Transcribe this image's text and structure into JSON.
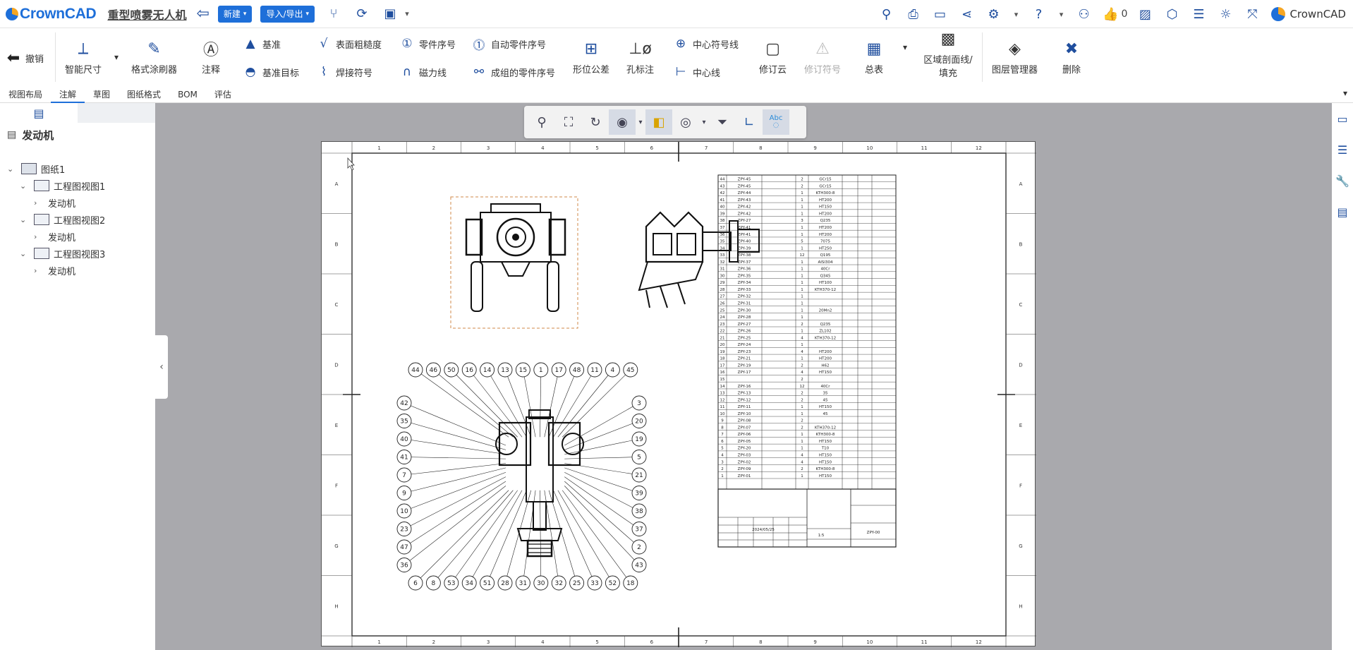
{
  "app": {
    "brand": "CrownCAD",
    "doc_title": "重型喷雾无人机",
    "new_label": "新建",
    "import_export_label": "导入/导出",
    "like_count": "0",
    "user_brand": "CrownCAD"
  },
  "ribbon": {
    "undo": "撤销",
    "smart_dimension": "智能尺寸",
    "format_painter": "格式涂刷器",
    "note": "注释",
    "datum": "基准",
    "datum_target": "基准目标",
    "surface_roughness": "表面粗糙度",
    "weld_symbol": "焊接符号",
    "balloon": "零件序号",
    "magnetic_line": "磁力线",
    "auto_balloon": "自动零件序号",
    "stacked_balloon": "成组的零件序号",
    "geometric_tolerance": "形位公差",
    "hole_callout": "孔标注",
    "center_mark": "中心符号线",
    "centerline": "中心线",
    "revision_cloud": "修订云",
    "revision_symbol": "修订符号",
    "table": "总表",
    "area_hatch_1": "区域剖面线/",
    "area_hatch_2": "填充",
    "layer_manager": "图层管理器",
    "delete": "删除"
  },
  "tabs": [
    "视图布局",
    "注解",
    "草图",
    "图纸格式",
    "BOM",
    "评估"
  ],
  "active_tab": 1,
  "tree": {
    "root": "发动机",
    "sheet": "图纸1",
    "views": [
      {
        "name": "工程图视图1",
        "child": "发动机"
      },
      {
        "name": "工程图视图2",
        "child": "发动机"
      },
      {
        "name": "工程图视图3",
        "child": "发动机"
      }
    ]
  },
  "drawing": {
    "col_numbers": [
      "1",
      "2",
      "3",
      "4",
      "5",
      "6",
      "7",
      "8",
      "9",
      "10",
      "11",
      "12"
    ],
    "row_letters": [
      "A",
      "B",
      "C",
      "D",
      "E",
      "F",
      "G",
      "H"
    ],
    "balloons_top": [
      "44",
      "46",
      "50",
      "16",
      "14",
      "13",
      "15",
      "1",
      "17",
      "48",
      "11",
      "4",
      "45"
    ],
    "balloons_left": [
      "42",
      "35",
      "40",
      "41",
      "7",
      "9",
      "10",
      "23",
      "47",
      "36"
    ],
    "balloons_right": [
      "3",
      "20",
      "19",
      "5",
      "21",
      "39",
      "38",
      "37",
      "2",
      "43"
    ],
    "balloons_bottom": [
      "6",
      "8",
      "53",
      "34",
      "51",
      "28",
      "31",
      "30",
      "32",
      "25",
      "33",
      "52",
      "18"
    ],
    "bom_rows": [
      [
        "44",
        "ZPY-45",
        "2",
        "GCr15"
      ],
      [
        "43",
        "ZPY-45",
        "2",
        "GCr15"
      ],
      [
        "42",
        "ZPY-44",
        "1",
        "KTH300-8"
      ],
      [
        "41",
        "ZPY-43",
        "1",
        "HT200"
      ],
      [
        "40",
        "ZPY-42",
        "1",
        "HT150"
      ],
      [
        "39",
        "ZPY-42",
        "1",
        "HT200"
      ],
      [
        "38",
        "ZPY-27",
        "3",
        "Q235"
      ],
      [
        "37",
        "ZPY-41",
        "1",
        "HT200"
      ],
      [
        "36",
        "ZPY-41",
        "1",
        "HT200"
      ],
      [
        "35",
        "ZPY-40",
        "5",
        "7075"
      ],
      [
        "34",
        "ZPY-39",
        "1",
        "HT250"
      ],
      [
        "33",
        "ZPY-38",
        "12",
        "Q195"
      ],
      [
        "32",
        "ZPY-37",
        "1",
        "AISI304"
      ],
      [
        "31",
        "ZPY-36",
        "1",
        "40Cr"
      ],
      [
        "30",
        "ZPY-35",
        "1",
        "Q345"
      ],
      [
        "29",
        "ZPY-34",
        "1",
        "HT100"
      ],
      [
        "28",
        "ZPY-33",
        "1",
        "KTH370-12"
      ],
      [
        "27",
        "ZPY-32",
        "1",
        "",
        ""
      ],
      [
        "26",
        "ZPY-31",
        "1",
        ""
      ],
      [
        "25",
        "ZPY-30",
        "1",
        "20Mn2"
      ],
      [
        "24",
        "ZPY-28",
        "1",
        ""
      ],
      [
        "23",
        "ZPY-27",
        "2",
        "Q235"
      ],
      [
        "22",
        "ZPY-26",
        "1",
        "ZL102"
      ],
      [
        "21",
        "ZPY-25",
        "4",
        "KTH370-12"
      ],
      [
        "20",
        "ZPY-24",
        "1",
        ""
      ],
      [
        "19",
        "ZPY-23",
        "4",
        "HT200"
      ],
      [
        "18",
        "ZPY-21",
        "1",
        "HT200"
      ],
      [
        "17",
        "ZPY-19",
        "2",
        "H62"
      ],
      [
        "16",
        "ZPY-17",
        "4",
        "HT150"
      ],
      [
        "15",
        "",
        "2",
        ""
      ],
      [
        "14",
        "ZPY-16",
        "12",
        "40Cr"
      ],
      [
        "13",
        "ZPY-13",
        "2",
        "35"
      ],
      [
        "12",
        "ZPY-12",
        "2",
        "45"
      ],
      [
        "11",
        "ZPY-11",
        "1",
        "HT150"
      ],
      [
        "10",
        "ZPY-10",
        "1",
        "45"
      ],
      [
        "9",
        "ZPY-08",
        "2",
        ""
      ],
      [
        "8",
        "ZPY-07",
        "2",
        "KTH370-12"
      ],
      [
        "7",
        "ZPY-06",
        "1",
        "KTH300-8"
      ],
      [
        "6",
        "ZPY-05",
        "1",
        "HT150"
      ],
      [
        "5",
        "ZPY-20",
        "1",
        "T10"
      ],
      [
        "4",
        "ZPY-03",
        "4",
        "HT150"
      ],
      [
        "3",
        "ZPY-02",
        "4",
        "HT150"
      ],
      [
        "2",
        "ZPY-09",
        "2",
        "KTH300-8"
      ],
      [
        "1",
        "ZPY-01",
        "1",
        "HT150"
      ]
    ],
    "title_block": {
      "drawing_no": "ZPY-00",
      "date": "2024/05/25",
      "scale": "1:5"
    }
  }
}
